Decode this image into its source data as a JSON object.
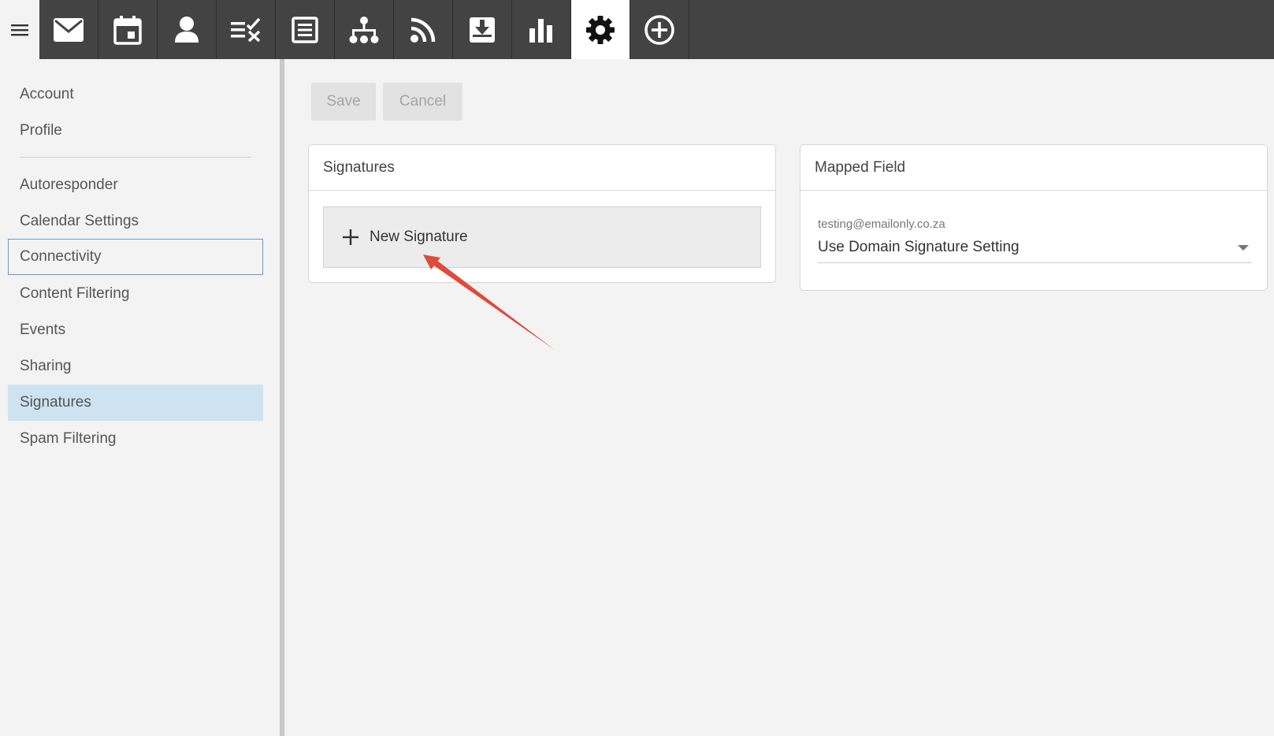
{
  "toolbar": {
    "menu_icon": "hamburger-menu-icon",
    "tools": [
      {
        "icon": "mail-icon",
        "active": false
      },
      {
        "icon": "calendar-icon",
        "active": false
      },
      {
        "icon": "contacts-icon",
        "active": false
      },
      {
        "icon": "tasks-icon",
        "active": false
      },
      {
        "icon": "notes-icon",
        "active": false
      },
      {
        "icon": "org-chart-icon",
        "active": false
      },
      {
        "icon": "rss-icon",
        "active": false
      },
      {
        "icon": "download-icon",
        "active": false
      },
      {
        "icon": "stats-icon",
        "active": false
      },
      {
        "icon": "settings-gear-icon",
        "active": true
      },
      {
        "icon": "add-circle-icon",
        "active": false
      }
    ]
  },
  "sidebar": {
    "items": [
      {
        "label": "Account"
      },
      {
        "label": "Profile"
      },
      {
        "label": "Autoresponder"
      },
      {
        "label": "Calendar Settings"
      },
      {
        "label": "Connectivity",
        "state": "focused"
      },
      {
        "label": "Content Filtering"
      },
      {
        "label": "Events"
      },
      {
        "label": "Sharing"
      },
      {
        "label": "Signatures",
        "state": "selected"
      },
      {
        "label": "Spam Filtering"
      }
    ]
  },
  "actions": {
    "save_label": "Save",
    "cancel_label": "Cancel"
  },
  "signatures_card": {
    "title": "Signatures",
    "new_signature_label": "New Signature"
  },
  "mapped_card": {
    "title": "Mapped Field",
    "email": "testing@emailonly.co.za",
    "selected_value": "Use Domain Signature Setting"
  },
  "colors": {
    "toolbar_bg": "#434343",
    "selected_item_bg": "#cde3f1",
    "focus_border": "#5e9ed6",
    "annotation_arrow": "#e04a3a"
  }
}
